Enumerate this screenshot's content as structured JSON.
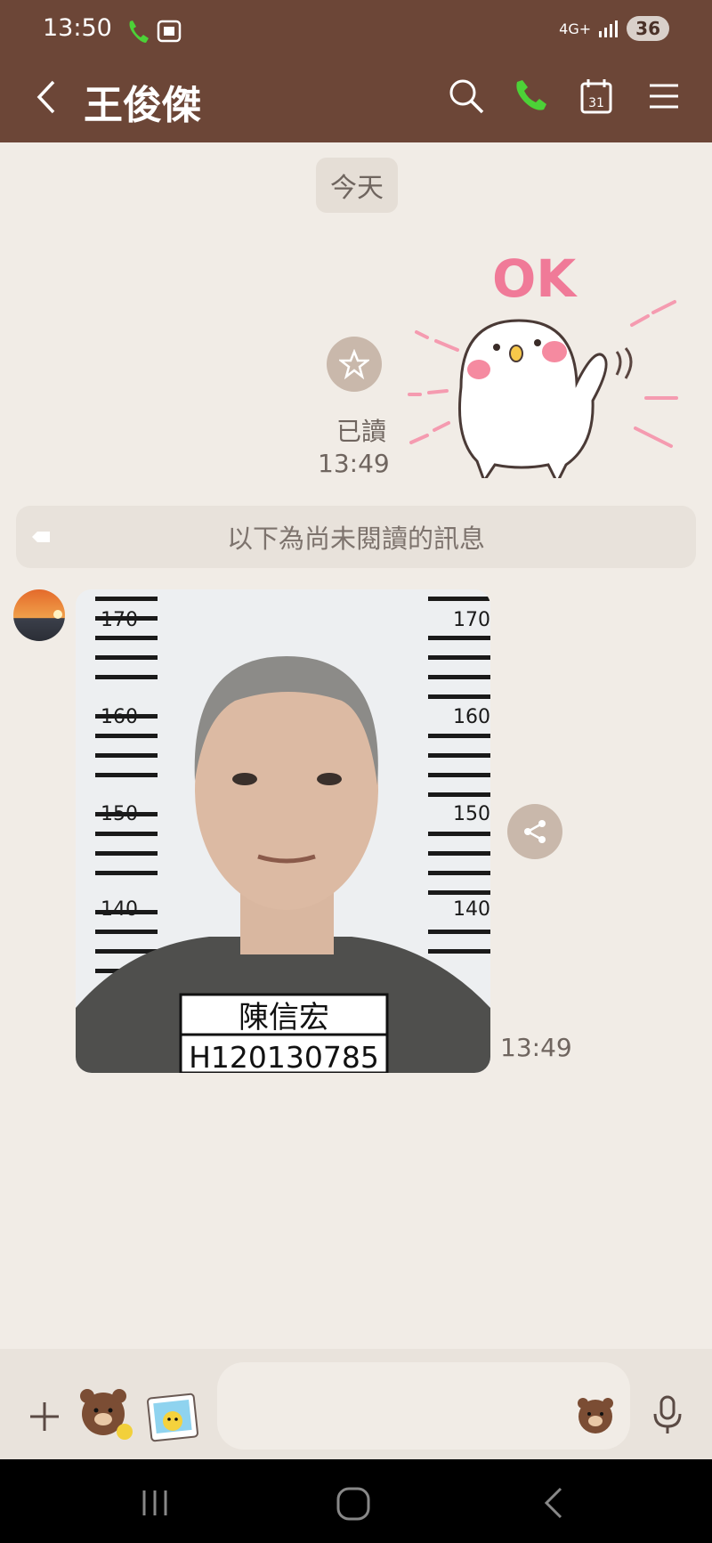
{
  "status_bar": {
    "time": "13:50",
    "network": "4G+",
    "battery": "36"
  },
  "header": {
    "title": "王俊傑"
  },
  "chat": {
    "date_separator": "今天",
    "sent_sticker": {
      "read_label": "已讀",
      "time": "13:49",
      "sticker_text": "OK"
    },
    "unread_divider": "以下為尚未閱讀的訊息",
    "received_image": {
      "time": "13:49",
      "name_plate": "陳信宏",
      "id_plate": "H120130785",
      "height_ticks": [
        "170",
        "160",
        "150",
        "140"
      ]
    }
  },
  "input": {
    "placeholder": ""
  },
  "colors": {
    "header_bg": "#6c4637",
    "chat_bg": "#f1ece6",
    "call_green": "#4cd137"
  }
}
